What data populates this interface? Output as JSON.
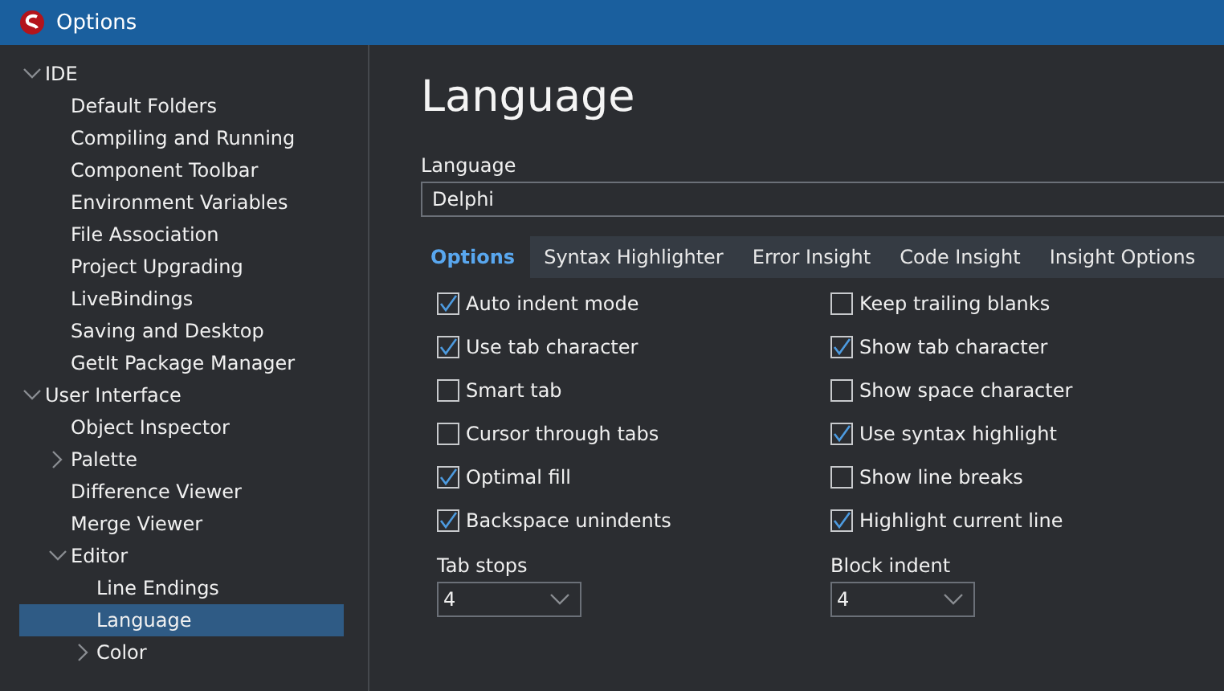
{
  "window": {
    "title": "Options"
  },
  "tree": [
    {
      "label": "IDE",
      "expanded": true,
      "selected": false,
      "children": [
        {
          "label": "Default Folders",
          "selected": false
        },
        {
          "label": "Compiling and Running",
          "selected": false
        },
        {
          "label": "Component Toolbar",
          "selected": false
        },
        {
          "label": "Environment Variables",
          "selected": false
        },
        {
          "label": "File Association",
          "selected": false
        },
        {
          "label": "Project Upgrading",
          "selected": false
        },
        {
          "label": "LiveBindings",
          "selected": false
        },
        {
          "label": "Saving and Desktop",
          "selected": false
        },
        {
          "label": "GetIt Package Manager",
          "selected": false
        }
      ]
    },
    {
      "label": "User Interface",
      "expanded": true,
      "selected": false,
      "children": [
        {
          "label": "Object Inspector",
          "selected": false
        },
        {
          "label": "Palette",
          "expanded": false,
          "selected": false
        },
        {
          "label": "Difference Viewer",
          "selected": false
        },
        {
          "label": "Merge Viewer",
          "selected": false
        },
        {
          "label": "Editor",
          "expanded": true,
          "selected": false,
          "children": [
            {
              "label": "Line Endings",
              "selected": false
            },
            {
              "label": "Language",
              "selected": true
            },
            {
              "label": "Color",
              "expanded": false,
              "selected": false
            }
          ]
        }
      ]
    }
  ],
  "page": {
    "heading": "Language",
    "language_label": "Language",
    "language_value": "Delphi",
    "tabs": [
      {
        "label": "Options",
        "selected": true
      },
      {
        "label": "Syntax Highlighter",
        "selected": false
      },
      {
        "label": "Error Insight",
        "selected": false
      },
      {
        "label": "Code Insight",
        "selected": false
      },
      {
        "label": "Insight Options",
        "selected": false
      }
    ],
    "left_options": [
      {
        "label": "Auto indent mode",
        "checked": true
      },
      {
        "label": "Use tab character",
        "checked": true
      },
      {
        "label": "Smart tab",
        "checked": false
      },
      {
        "label": "Cursor through tabs",
        "checked": false
      },
      {
        "label": "Optimal fill",
        "checked": true
      },
      {
        "label": "Backspace unindents",
        "checked": true
      }
    ],
    "right_options": [
      {
        "label": "Keep trailing blanks",
        "checked": false
      },
      {
        "label": "Show tab character",
        "checked": true
      },
      {
        "label": "Show space character",
        "checked": false
      },
      {
        "label": "Use syntax highlight",
        "checked": true
      },
      {
        "label": "Show line breaks",
        "checked": false
      },
      {
        "label": "Highlight current line",
        "checked": true
      }
    ],
    "tab_stops": {
      "label": "Tab stops",
      "value": "4"
    },
    "block_indent": {
      "label": "Block indent",
      "value": "4"
    }
  }
}
